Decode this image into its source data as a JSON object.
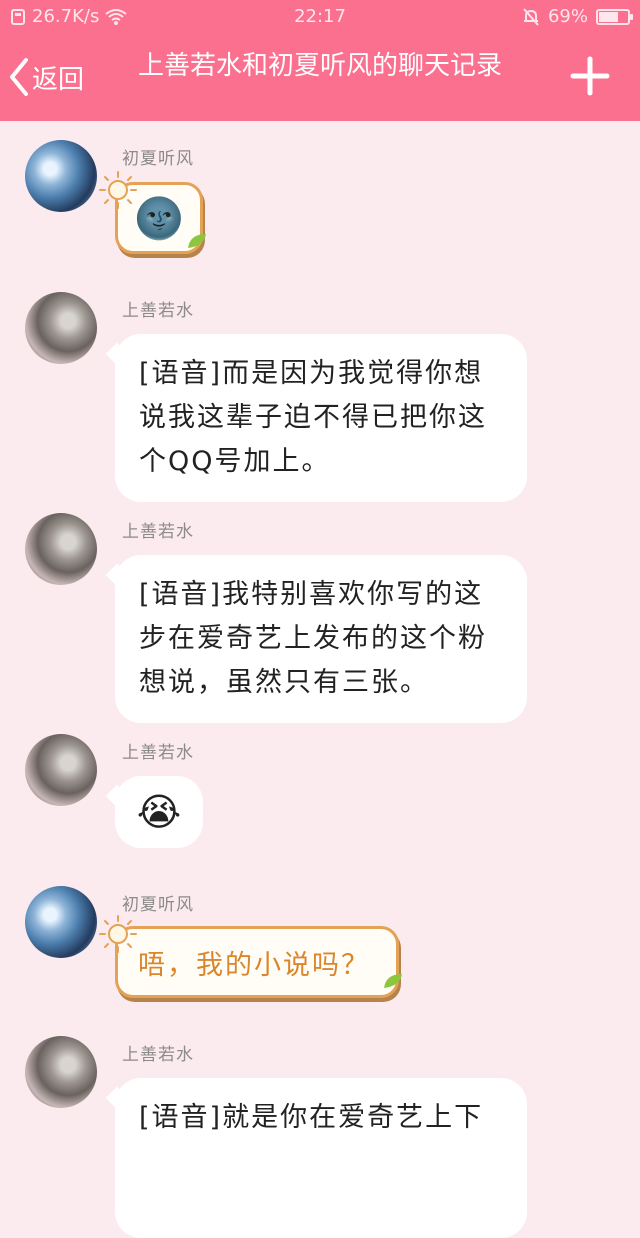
{
  "status_bar": {
    "network_speed": "26.7K/s",
    "time": "22:17",
    "battery_pct": "69%",
    "battery_level": 0.69
  },
  "header": {
    "back_label": "返回",
    "title": "上善若水和初夏听风的聊天记录",
    "add_icon": "plus-icon"
  },
  "messages": [
    {
      "sender": "初夏听风",
      "type": "emoji",
      "emoji": "🌚"
    },
    {
      "sender": "上善若水",
      "type": "text",
      "lines": [
        "[语音]而是因为我觉得你想",
        "说我这辈子迫不得已把你这",
        "个QQ号加上。"
      ]
    },
    {
      "sender": "上善若水",
      "type": "text",
      "lines": [
        "[语音]我特别喜欢你写的这",
        "步在爱奇艺上发布的这个粉",
        "想说，虽然只有三张。"
      ]
    },
    {
      "sender": "上善若水",
      "type": "emoji",
      "emoji": "😭"
    },
    {
      "sender": "初夏听风",
      "type": "text",
      "text": "唔，我的小说吗？"
    },
    {
      "sender": "上善若水",
      "type": "text",
      "lines": [
        "[语音]就是你在爱奇艺上下"
      ]
    }
  ],
  "colors": {
    "header_bg": "#fb6f8f",
    "chat_bg": "#fcebee",
    "themed_text": "#d9862c"
  }
}
